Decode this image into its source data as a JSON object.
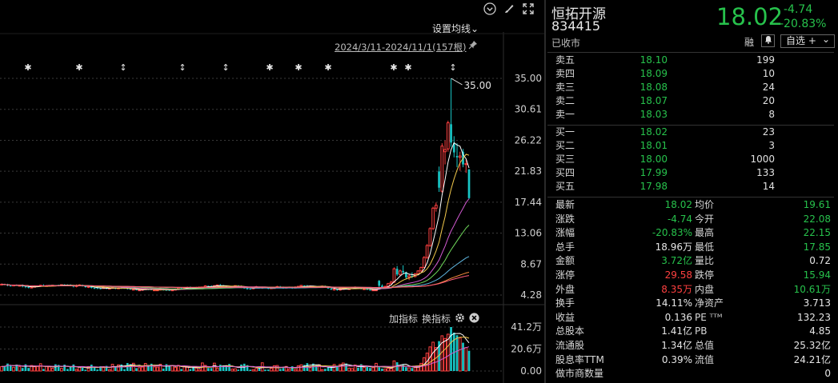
{
  "toolbar": {
    "ma_setting_label": "设置均线",
    "ma_setting_chevron": "⌄",
    "date_range": "2024/3/11-2024/11/1(157根)",
    "indicator_add": "加指标",
    "indicator_switch": "换指标"
  },
  "icons": {
    "collapse": "chevron-down-circle-icon",
    "draw": "brush-icon",
    "fullscreen": "expand-icon",
    "pin": "pin-icon",
    "settings": "gear-icon",
    "close": "close-circle-icon",
    "bell": "bell-icon"
  },
  "colors": {
    "up": "#ff4040",
    "down": "#27c24c",
    "down_candle": "#19c6c6",
    "ma5": "#ffffff",
    "ma10": "#f2c84b",
    "ma20": "#d45bd4",
    "ma30": "#6fd95b",
    "ma60": "#5fb6e0",
    "ma120": "#f08a3a",
    "ma250": "#ff5a7a"
  },
  "chart_data": {
    "type": "candlestick",
    "price_axis_labels": [
      "35.00",
      "30.61",
      "26.22",
      "21.83",
      "17.44",
      "13.06",
      "8.67",
      "4.28"
    ],
    "price_axis_range": [
      4.28,
      35.0
    ],
    "volume_axis_labels": [
      "41.2万",
      "20.6万",
      "0.00"
    ],
    "volume_axis_range": [
      0,
      41.2
    ],
    "high_marker": "35.00",
    "event_markers": [
      "✱",
      "✱",
      "↕",
      "↕",
      "↕",
      "✱",
      "✱",
      "✱",
      "✱",
      "✱",
      "↕"
    ],
    "candles_recent": [
      {
        "o": 6.3,
        "h": 6.4,
        "l": 5.2,
        "c": 5.6
      },
      {
        "o": 5.6,
        "h": 5.8,
        "l": 5.3,
        "c": 5.4
      },
      {
        "o": 5.4,
        "h": 5.6,
        "l": 5.2,
        "c": 5.5
      },
      {
        "o": 5.5,
        "h": 6.0,
        "l": 5.4,
        "c": 5.9
      },
      {
        "o": 5.9,
        "h": 6.3,
        "l": 5.7,
        "c": 6.1
      },
      {
        "o": 6.1,
        "h": 8.2,
        "l": 6.0,
        "c": 8.0
      },
      {
        "o": 8.0,
        "h": 8.4,
        "l": 7.0,
        "c": 7.2
      },
      {
        "o": 7.2,
        "h": 7.9,
        "l": 7.0,
        "c": 7.7
      },
      {
        "o": 7.7,
        "h": 8.5,
        "l": 7.3,
        "c": 7.5
      },
      {
        "o": 7.5,
        "h": 7.6,
        "l": 6.5,
        "c": 6.8
      },
      {
        "o": 6.8,
        "h": 7.2,
        "l": 6.4,
        "c": 7.0
      },
      {
        "o": 7.0,
        "h": 7.5,
        "l": 6.7,
        "c": 6.9
      },
      {
        "o": 6.9,
        "h": 7.4,
        "l": 6.8,
        "c": 7.3
      },
      {
        "o": 7.3,
        "h": 7.8,
        "l": 7.1,
        "c": 7.7
      },
      {
        "o": 7.7,
        "h": 8.3,
        "l": 7.5,
        "c": 8.2
      },
      {
        "o": 8.2,
        "h": 9.8,
        "l": 8.1,
        "c": 9.6
      },
      {
        "o": 9.6,
        "h": 11.5,
        "l": 9.4,
        "c": 11.3
      },
      {
        "o": 11.3,
        "h": 13.9,
        "l": 11.1,
        "c": 13.7
      },
      {
        "o": 13.7,
        "h": 16.8,
        "l": 13.5,
        "c": 16.6
      },
      {
        "o": 16.6,
        "h": 17.4,
        "l": 16.1,
        "c": 17.0
      },
      {
        "o": 21.8,
        "h": 22.5,
        "l": 18.9,
        "c": 19.5
      },
      {
        "o": 19.0,
        "h": 25.8,
        "l": 18.8,
        "c": 25.4
      },
      {
        "o": 24.6,
        "h": 26.2,
        "l": 22.8,
        "c": 24.9
      },
      {
        "o": 25.0,
        "h": 29.0,
        "l": 24.6,
        "c": 28.7
      },
      {
        "o": 28.5,
        "h": 35.0,
        "l": 25.3,
        "c": 25.9
      },
      {
        "o": 25.8,
        "h": 26.8,
        "l": 23.8,
        "c": 24.5
      },
      {
        "o": 24.0,
        "h": 25.8,
        "l": 22.4,
        "c": 23.8
      },
      {
        "o": 23.8,
        "h": 24.6,
        "l": 21.9,
        "c": 24.0
      },
      {
        "o": 24.6,
        "h": 25.0,
        "l": 22.4,
        "c": 22.8
      },
      {
        "o": 22.8,
        "h": 23.5,
        "l": 21.6,
        "c": 22.9
      },
      {
        "o": 22.08,
        "h": 22.15,
        "l": 17.85,
        "c": 18.02
      }
    ]
  },
  "quote": {
    "name": "恒拓开源",
    "code": "834415",
    "status": "已收市",
    "price": "18.02",
    "change": "-4.74",
    "change_pct": "-20.83%",
    "rong": "融",
    "watch_label": "自选 +",
    "watch_chevron": "⌄"
  },
  "order_book": {
    "asks": [
      {
        "label": "卖五",
        "price": "18.10",
        "vol": "199"
      },
      {
        "label": "卖四",
        "price": "18.09",
        "vol": "10"
      },
      {
        "label": "卖三",
        "price": "18.08",
        "vol": "24"
      },
      {
        "label": "卖二",
        "price": "18.07",
        "vol": "20"
      },
      {
        "label": "卖一",
        "price": "18.03",
        "vol": "8"
      }
    ],
    "bids": [
      {
        "label": "买一",
        "price": "18.02",
        "vol": "23"
      },
      {
        "label": "买二",
        "price": "18.01",
        "vol": "3"
      },
      {
        "label": "买三",
        "price": "18.00",
        "vol": "1000"
      },
      {
        "label": "买四",
        "price": "17.99",
        "vol": "133"
      },
      {
        "label": "买五",
        "price": "17.98",
        "vol": "14"
      }
    ]
  },
  "stats": [
    {
      "l1": "最新",
      "v1": "18.02",
      "c1": "green",
      "l2": "均价",
      "v2": "19.61",
      "c2": "green"
    },
    {
      "l1": "涨跌",
      "v1": "-4.74",
      "c1": "green",
      "l2": "今开",
      "v2": "22.08",
      "c2": "green"
    },
    {
      "l1": "涨幅",
      "v1": "-20.83%",
      "c1": "green",
      "l2": "最高",
      "v2": "22.15",
      "c2": "green"
    },
    {
      "l1": "总手",
      "v1": "18.96万",
      "c1": "white",
      "l2": "最低",
      "v2": "17.85",
      "c2": "green"
    },
    {
      "l1": "金额",
      "v1": "3.72亿",
      "c1": "green",
      "l2": "量比",
      "v2": "0.72",
      "c2": "white"
    },
    {
      "l1": "涨停",
      "v1": "29.58",
      "c1": "red",
      "l2": "跌停",
      "v2": "15.94",
      "c2": "green"
    },
    {
      "l1": "外盘",
      "v1": "8.35万",
      "c1": "red",
      "l2": "内盘",
      "v2": "10.61万",
      "c2": "green"
    },
    {
      "l1": "换手",
      "v1": "14.11%",
      "c1": "white",
      "l2": "净资产",
      "v2": "3.713",
      "c2": "white"
    },
    {
      "l1": "收益",
      "v1": "0.136",
      "c1": "white",
      "l2": "PE ᵀᵀᴹ",
      "v2": "132.23",
      "c2": "white"
    },
    {
      "l1": "总股本",
      "v1": "1.41亿",
      "c1": "white",
      "l2": "PB",
      "v2": "4.85",
      "c2": "white"
    },
    {
      "l1": "流通股",
      "v1": "1.34亿",
      "c1": "white",
      "l2": "总值",
      "v2": "25.32亿",
      "c2": "white"
    },
    {
      "l1": "股息率TTM",
      "v1": "0.39%",
      "c1": "white",
      "l2": "流值",
      "v2": "24.21亿",
      "c2": "white"
    },
    {
      "l1": "做市商数量",
      "v1": "",
      "c1": "white",
      "l2": "",
      "v2": "0",
      "c2": "white"
    }
  ]
}
